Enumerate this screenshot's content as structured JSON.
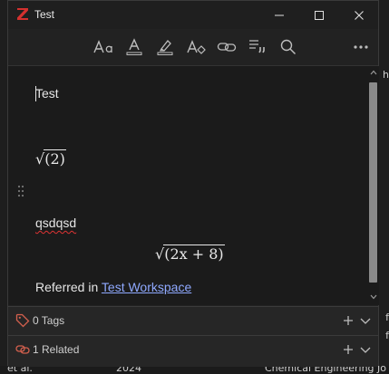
{
  "window": {
    "title": "Test",
    "app_icon": "zotero-z-icon",
    "accent": "#d4312f"
  },
  "toolbar": {
    "buttons": [
      {
        "name": "text-format-icon"
      },
      {
        "name": "text-color-icon"
      },
      {
        "name": "highlight-icon"
      },
      {
        "name": "clear-formatting-icon"
      },
      {
        "name": "insert-link-icon"
      },
      {
        "name": "insert-citation-icon"
      },
      {
        "name": "find-replace-icon"
      },
      {
        "name": "more-icon"
      }
    ]
  },
  "note": {
    "heading": "Test",
    "math1": "√(2)",
    "math1_radicand": "(2)",
    "misspelled": "qsdqsd",
    "math2_radicand": "(2x + 8)",
    "referred_prefix": "Referred in ",
    "referred_link": "Test Workspace"
  },
  "panels": {
    "tags": "0 Tags",
    "related": "1 Related"
  },
  "background": {
    "right_edge": [
      "h",
      "f",
      "f"
    ],
    "bottom_left": "et al.",
    "bottom_mid": "2024",
    "bottom_right": "Chemical Engineering Jo"
  }
}
